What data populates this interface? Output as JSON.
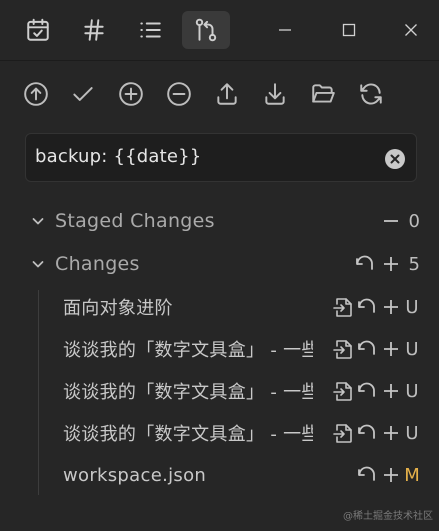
{
  "tabs": [
    {
      "icon": "calendar-check-icon"
    },
    {
      "icon": "hash-icon"
    },
    {
      "icon": "list-icon"
    },
    {
      "icon": "git-compare-icon",
      "active": true
    }
  ],
  "window_controls": [
    "minimize-icon",
    "maximize-icon",
    "close-icon"
  ],
  "toolbar": [
    "arrow-up-circle-icon",
    "check-icon",
    "plus-circle-icon",
    "minus-circle-icon",
    "upload-icon",
    "download-icon",
    "folder-open-icon",
    "refresh-icon"
  ],
  "commit": {
    "message": "backup: {{date}}"
  },
  "staged": {
    "title": "Staged Changes",
    "count": "0"
  },
  "changes": {
    "title": "Changes",
    "count": "5",
    "files": [
      {
        "name": "面向对象进阶",
        "status": "U"
      },
      {
        "name": "谈谈我的「数字文具盒」 - 一些",
        "status": "U"
      },
      {
        "name": "谈谈我的「数字文具盒」 - 一些",
        "status": "U"
      },
      {
        "name": "谈谈我的「数字文具盒」 - 一些",
        "status": "U"
      },
      {
        "name": "workspace.json",
        "status": "M"
      }
    ]
  },
  "colors": {
    "background": "#262626",
    "modified": "#e5b14a"
  },
  "watermark": "@稀土掘金技术社区"
}
